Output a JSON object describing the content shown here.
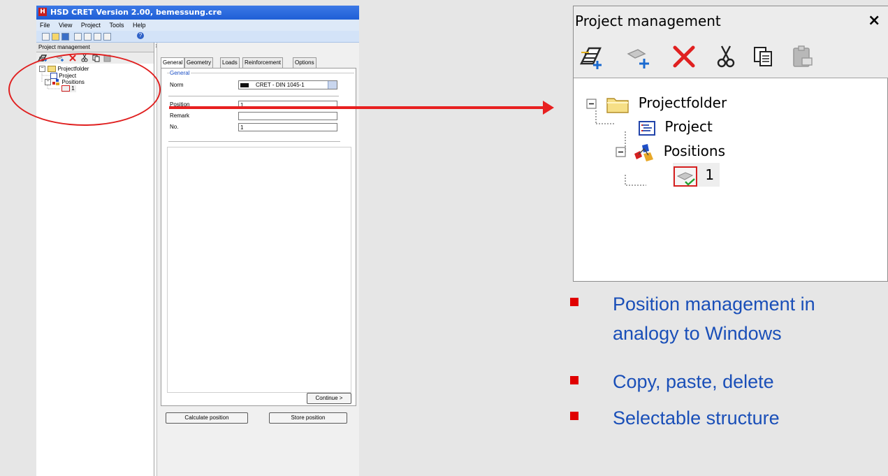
{
  "app": {
    "title": "HSD CRET Version 2.00, bemessung.cre",
    "icon_letter": "H",
    "menu": [
      "File",
      "View",
      "Project",
      "Tools",
      "Help"
    ],
    "help_icon_glyph": "?"
  },
  "project_panel": {
    "title": "Project management",
    "close": "×",
    "tools": [
      "new-folder-icon",
      "new-position-icon",
      "delete-icon",
      "cut-icon",
      "copy-icon",
      "paste-icon"
    ],
    "tree": {
      "root": "Projectfolder",
      "project": "Project",
      "positions": "Positions",
      "position_item": "1"
    },
    "expand_glyph": "⊟"
  },
  "editor": {
    "tabs": [
      "General",
      "Geometry",
      "Loads",
      "Reinforcement",
      "Options"
    ],
    "group_label": "General",
    "fields": [
      {
        "label": "Norm",
        "value": "CRET - DIN 1045-1"
      },
      {
        "label": "Position",
        "value": "1"
      },
      {
        "label": "Remark",
        "value": ""
      },
      {
        "label": "No.",
        "value": "1"
      }
    ],
    "continue_label": "Continue >",
    "calculate_label": "Calculate position",
    "store_label": "Store position"
  },
  "zoom_panel": {
    "title": "Project management",
    "close": "×",
    "tree": {
      "root": "Projectfolder",
      "project": "Project",
      "positions": "Positions",
      "position_item": "1"
    }
  },
  "bullets": [
    {
      "line1": "Position management in",
      "line2": "analogy to Windows"
    },
    {
      "line1": "Copy, paste, delete"
    },
    {
      "line1": "Selectable structure"
    }
  ],
  "colors": {
    "annotation_red": "#e02020",
    "bullet_red": "#e00000",
    "bullet_text": "#1a4fb8",
    "titlebar": "#2a68dc"
  }
}
